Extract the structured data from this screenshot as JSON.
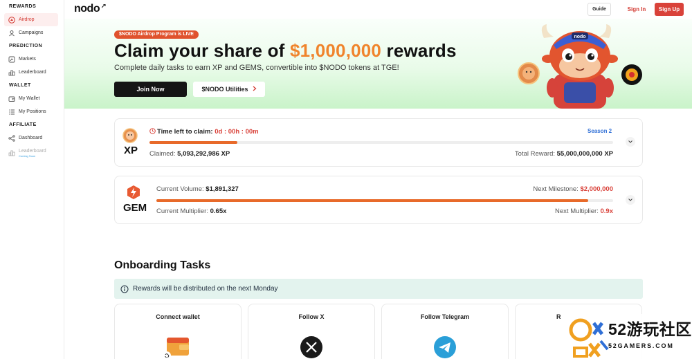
{
  "sidebar": {
    "sections": [
      {
        "title": "REWARDS",
        "items": [
          {
            "label": "Airdrop"
          },
          {
            "label": "Campaigns"
          }
        ]
      },
      {
        "title": "PREDICTION",
        "items": [
          {
            "label": "Markets"
          },
          {
            "label": "Leaderboard"
          }
        ]
      },
      {
        "title": "WALLET",
        "items": [
          {
            "label": "My Wallet"
          },
          {
            "label": "My Positions"
          }
        ]
      },
      {
        "title": "AFFILIATE",
        "items": [
          {
            "label": "Dashboard"
          },
          {
            "label": "Leaderboard",
            "note": "Coming Soon"
          }
        ]
      }
    ]
  },
  "header": {
    "logo": "nodo",
    "guide_label": "Guide",
    "signin_label": "Sign In",
    "signup_label": "Sign Up"
  },
  "hero": {
    "badge": "$NODO Airdrop Program is LIVE",
    "title_pre": "Claim your share of ",
    "title_amount": "$1,000,000",
    "title_post": " rewards",
    "subtitle": "Complete daily tasks to earn XP and GEMS, convertible into $NODO tokens at TGE!",
    "join_label": "Join Now",
    "utilities_label": "$NODO Utilities",
    "mascot_cap_text": "nodo"
  },
  "xp_card": {
    "token_label": "XP",
    "timer_label": "Time left to claim:",
    "timer_value": "0d : 00h : 00m",
    "season": "Season 2",
    "progress": 0.19,
    "claimed_label": "Claimed:",
    "claimed_value": "5,093,292,986 XP",
    "total_label": "Total Reward:",
    "total_value": "55,000,000,000 XP"
  },
  "gem_card": {
    "token_label": "GEM",
    "volume_label": "Current Volume:",
    "volume_value": "$1,891,327",
    "milestone_label": "Next Milestone:",
    "milestone_value": "$2,000,000",
    "progress": 0.946,
    "multiplier_label": "Current Multiplier:",
    "multiplier_value": "0.65x",
    "next_multiplier_label": "Next Multiplier:",
    "next_multiplier_value": "0.9x"
  },
  "onboarding": {
    "title": "Onboarding Tasks",
    "notice": "Rewards will be distributed on the next Monday",
    "tasks": [
      {
        "title": "Connect wallet",
        "icon": "wallet-icon"
      },
      {
        "title": "Follow X",
        "icon": "x-logo-icon"
      },
      {
        "title": "Follow Telegram",
        "icon": "telegram-icon"
      },
      {
        "title": "R",
        "icon": "unknown"
      }
    ]
  },
  "watermark": {
    "line1": "52游玩社区",
    "line2": "52GAMERS.COM"
  },
  "colors": {
    "brand_red": "#d9423a",
    "accent_orange": "#f0842c",
    "progress_orange": "#e86a2a",
    "season_blue": "#2f6fd6",
    "hero_green": "#c9f3c9"
  }
}
